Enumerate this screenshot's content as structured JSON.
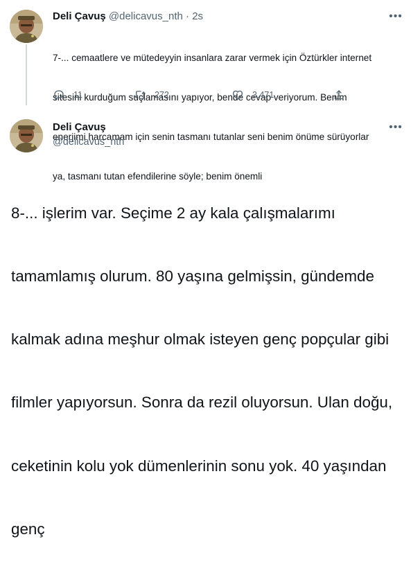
{
  "tweet1": {
    "display_name": "Deli Çavuş",
    "handle": "@delicavus_nth",
    "separator": "·",
    "time": "2s",
    "lines": [
      "7-... cemaatlere ve mütedeyyin insanlara zarar vermek için Öztürkler internet",
      "sitesini kurduğum suçlamasını yapıyor, bende cevap veriyorum. Benim",
      "enerjimi harcamam için senin tasmanı tutanlar seni benim önüme sürüyorlar",
      "ya, tasmanı tutan efendilerine söyle; benim önemli"
    ],
    "actions": {
      "replies": "11",
      "retweets": "272",
      "likes": "3.471"
    },
    "icons": [
      "reply-icon",
      "retweet-icon",
      "like-icon",
      "share-icon",
      "more-icon"
    ]
  },
  "tweet2": {
    "display_name": "Deli Çavuş",
    "handle": "@delicavus_nth",
    "lines": [
      "8-... işlerim var. Seçime 2 ay kala çalışmalarımı",
      "tamamlamış olurum. 80 yaşına gelmişsin, gündemde",
      "kalmak adına meşhur olmak isteyen genç popçular gibi",
      "filmler yapıyorsun. Sonra da rezil oluyorsun. Ulan doğu,",
      "ceketinin kolu yok dümenlerinin sonu yok. 40 yaşından",
      "genç"
    ]
  },
  "colors": {
    "text": "#0f1419",
    "muted": "#536471",
    "thread_line": "#cfd9de",
    "background": "#ffffff"
  }
}
